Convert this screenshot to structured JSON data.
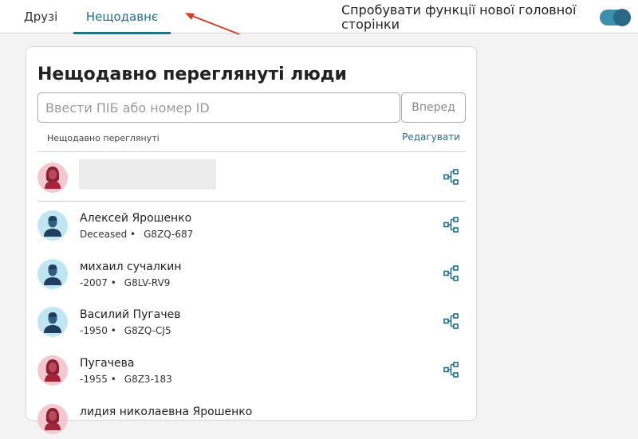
{
  "tabs": {
    "friends": "Друзі",
    "recent": "Нещодавнє"
  },
  "try_feature": "Спробувати функції нової головної сторінки",
  "card": {
    "title": "Нещодавно переглянуті люди",
    "search_placeholder": "Ввести ПІБ або номер ID",
    "go_button": "Вперед",
    "list_header": "Нещодавно переглянуті",
    "edit_link": "Редагувати"
  },
  "people": [
    {
      "name": "Алексей Ярошенко",
      "lifespan": "Deceased",
      "id": "G8ZQ-687",
      "gender": "male"
    },
    {
      "name": "михаил сучалкин",
      "lifespan": "-2007",
      "id": "G8LV-RV9",
      "gender": "male"
    },
    {
      "name": "Василий Пугачев",
      "lifespan": "-1950",
      "id": "G8ZQ-CJ5",
      "gender": "male"
    },
    {
      "name": "Пугачева",
      "lifespan": "-1955",
      "id": "G8Z3-183",
      "gender": "female"
    },
    {
      "name": "лидия николаевна Ярошенко",
      "lifespan": "",
      "id": "",
      "gender": "female"
    }
  ],
  "colors": {
    "accent": "#1f6e8f",
    "toggle": "#3d8fb0",
    "annotation_arrow": "#d0402b",
    "male_avatar_bg": "#bfe6f2",
    "female_avatar_bg": "#f3c9cf"
  }
}
